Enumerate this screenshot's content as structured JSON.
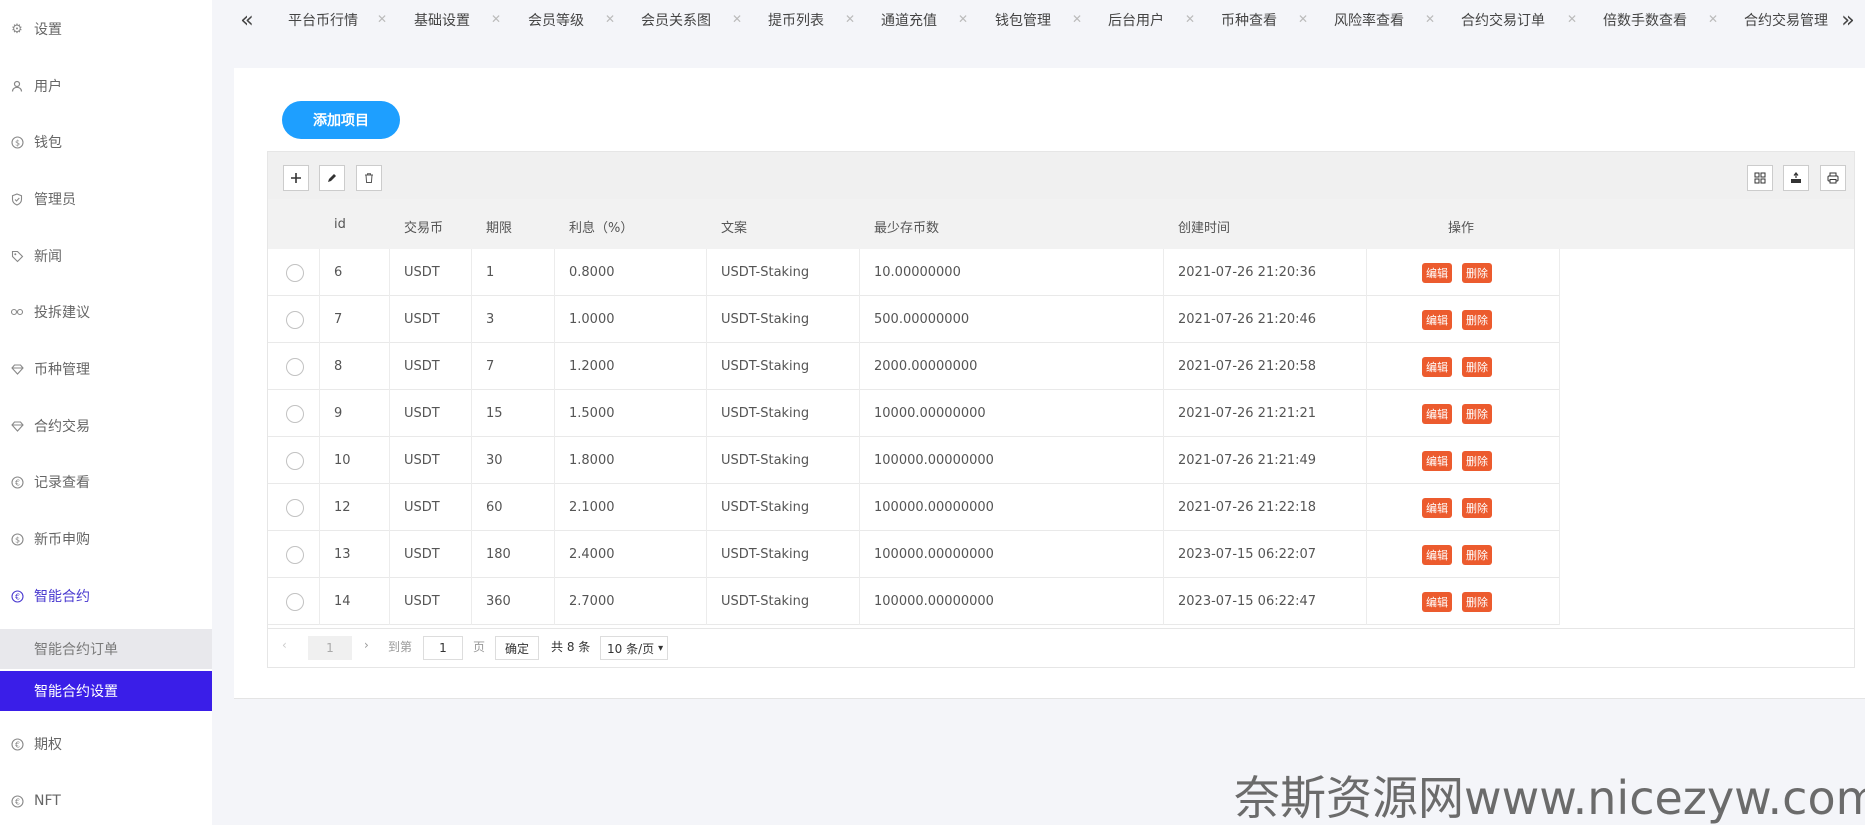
{
  "sidebar": {
    "items": [
      {
        "label": "设置",
        "icon": "gear-icon"
      },
      {
        "label": "用户",
        "icon": "user-icon"
      },
      {
        "label": "钱包",
        "icon": "dollar-icon"
      },
      {
        "label": "管理员",
        "icon": "shield-icon"
      },
      {
        "label": "新闻",
        "icon": "tag-icon"
      },
      {
        "label": "投拆建议",
        "icon": "link-icon"
      },
      {
        "label": "币种管理",
        "icon": "diamond-icon"
      },
      {
        "label": "合约交易",
        "icon": "diamond-icon"
      },
      {
        "label": "记录查看",
        "icon": "euro-icon"
      },
      {
        "label": "新币申购",
        "icon": "dollar-icon"
      },
      {
        "label": "智能合约",
        "icon": "euro-icon"
      }
    ],
    "subitems": [
      {
        "label": "智能合约订单"
      },
      {
        "label": "智能合约设置"
      }
    ],
    "bottom_items": [
      {
        "label": "期权",
        "icon": "euro-icon"
      },
      {
        "label": "NFT",
        "icon": "euro-icon"
      }
    ]
  },
  "tabs": [
    {
      "label": "平台币行情"
    },
    {
      "label": "基础设置"
    },
    {
      "label": "会员等级"
    },
    {
      "label": "会员关系图"
    },
    {
      "label": "提币列表"
    },
    {
      "label": "通道充值"
    },
    {
      "label": "钱包管理"
    },
    {
      "label": "后台用户"
    },
    {
      "label": "币种查看"
    },
    {
      "label": "风险率查看"
    },
    {
      "label": "合约交易订单"
    },
    {
      "label": "倍数手数查看"
    },
    {
      "label": "合约交易管理"
    }
  ],
  "add_button": "添加项目",
  "columns": [
    "id",
    "交易币",
    "期限",
    "利息（%）",
    "文案",
    "最少存币数",
    "创建时间",
    "操作"
  ],
  "rows": [
    {
      "id": "6",
      "coin": "USDT",
      "term": "1",
      "rate": "0.8000",
      "copy": "USDT-Staking",
      "min": "10.00000000",
      "created": "2021-07-26 21:20:36"
    },
    {
      "id": "7",
      "coin": "USDT",
      "term": "3",
      "rate": "1.0000",
      "copy": "USDT-Staking",
      "min": "500.00000000",
      "created": "2021-07-26 21:20:46"
    },
    {
      "id": "8",
      "coin": "USDT",
      "term": "7",
      "rate": "1.2000",
      "copy": "USDT-Staking",
      "min": "2000.00000000",
      "created": "2021-07-26 21:20:58"
    },
    {
      "id": "9",
      "coin": "USDT",
      "term": "15",
      "rate": "1.5000",
      "copy": "USDT-Staking",
      "min": "10000.00000000",
      "created": "2021-07-26 21:21:21"
    },
    {
      "id": "10",
      "coin": "USDT",
      "term": "30",
      "rate": "1.8000",
      "copy": "USDT-Staking",
      "min": "100000.00000000",
      "created": "2021-07-26 21:21:49"
    },
    {
      "id": "12",
      "coin": "USDT",
      "term": "60",
      "rate": "2.1000",
      "copy": "USDT-Staking",
      "min": "100000.00000000",
      "created": "2021-07-26 21:22:18"
    },
    {
      "id": "13",
      "coin": "USDT",
      "term": "180",
      "rate": "2.4000",
      "copy": "USDT-Staking",
      "min": "100000.00000000",
      "created": "2023-07-15 06:22:07"
    },
    {
      "id": "14",
      "coin": "USDT",
      "term": "360",
      "rate": "2.7000",
      "copy": "USDT-Staking",
      "min": "100000.00000000",
      "created": "2023-07-15 06:22:47"
    }
  ],
  "actions": {
    "edit": "编辑",
    "delete": "删除"
  },
  "pager": {
    "current": "1",
    "goto_label": "到第",
    "goto_value": "1",
    "page_unit": "页",
    "confirm": "确定",
    "total": "共 8 条",
    "page_size": "10 条/页"
  },
  "watermark": "奈斯资源网www.nicezyw.com",
  "colors": {
    "accent": "#1e9fff",
    "active_nav": "#3a1ee8",
    "action": "#ec5b2e"
  }
}
